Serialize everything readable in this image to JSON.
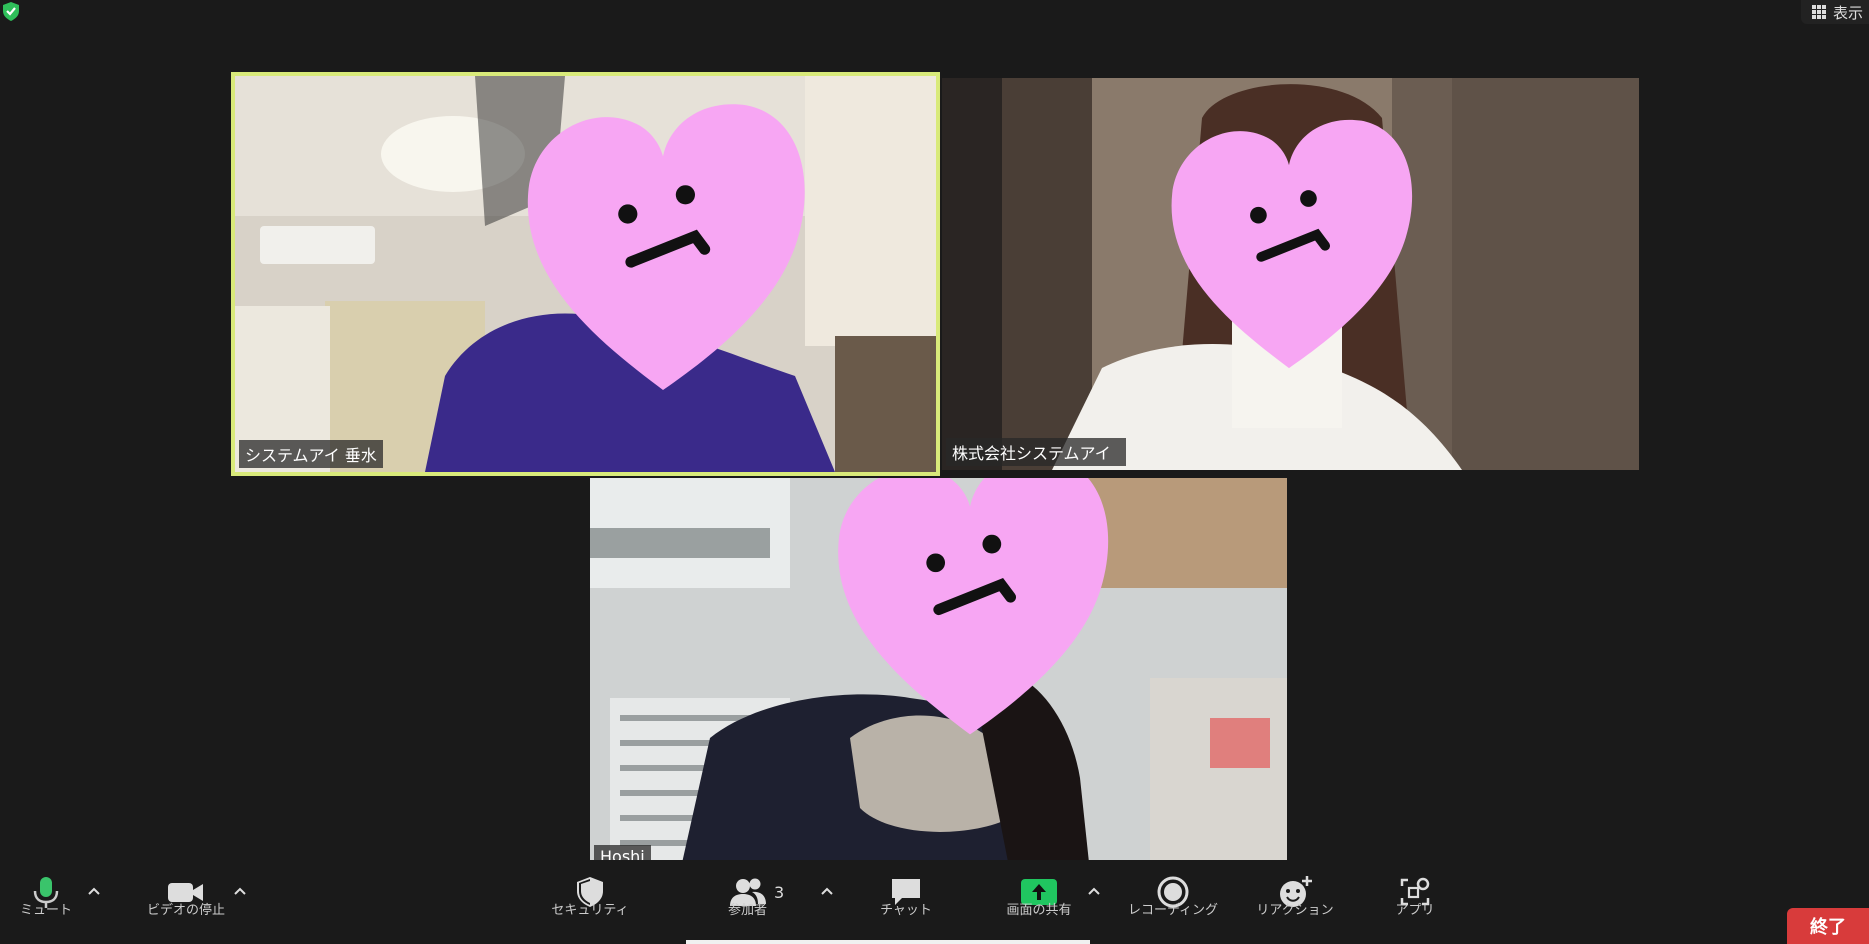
{
  "window": {
    "view_label": "表示"
  },
  "participants": [
    {
      "name": "システムアイ 垂水",
      "active_speaker": true
    },
    {
      "name": "株式会社システムアイ",
      "name_visible": "株式会",
      "name_tail": "アイ"
    },
    {
      "name": "Hoshi"
    }
  ],
  "toolbar": {
    "mute_label": "ミュート",
    "video_label": "ビデオの停止",
    "security_label": "セキュリティ",
    "participants_label": "参加者",
    "participants_count": "3",
    "chat_label": "チャット",
    "share_label": "画面の共有",
    "record_label": "レコーディング",
    "reactions_label": "リアクション",
    "apps_label": "アプリ",
    "end_label": "終了"
  },
  "colors": {
    "active_border": "#d9ea7a",
    "heart": "#f7a6f3",
    "end_button": "#d83b3b",
    "share_green": "#20c660",
    "mic_green": "#3ac46b"
  },
  "icons": [
    "shield-check-icon",
    "grid-icon",
    "microphone-icon",
    "video-camera-icon",
    "security-shield-icon",
    "participants-icon",
    "chat-bubble-icon",
    "share-screen-icon",
    "record-icon",
    "reaction-icon",
    "apps-icon",
    "chevron-up-icon"
  ]
}
